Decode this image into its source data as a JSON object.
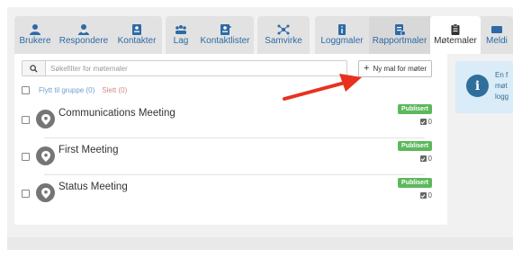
{
  "colors": {
    "link": "#2d6aa6",
    "badge_green": "#5cb85c",
    "annotation_red": "#e8321f",
    "info_bg": "#d9ecf7"
  },
  "tabs_group1": [
    {
      "label": "Brukere",
      "icon": "user-icon"
    },
    {
      "label": "Respondere",
      "icon": "respondent-icon"
    },
    {
      "label": "Kontakter",
      "icon": "contact-card-icon"
    }
  ],
  "tabs_group2": [
    {
      "label": "Lag",
      "icon": "team-icon"
    },
    {
      "label": "Kontaktlister",
      "icon": "contact-list-icon"
    }
  ],
  "tabs_group3": [
    {
      "label": "Samvirke",
      "icon": "network-icon"
    }
  ],
  "tabs_group4": [
    {
      "label": "Loggmaler",
      "icon": "log-template-icon"
    },
    {
      "label": "Rapportmaler",
      "icon": "report-template-icon"
    },
    {
      "label": "Møtemaler",
      "icon": "clipboard-icon"
    },
    {
      "label": "Meldi",
      "icon": "message-icon"
    }
  ],
  "search": {
    "placeholder": "Søkefilter for møtemaler",
    "icon": "search-icon"
  },
  "new_button": {
    "label": "Ny mal for møter"
  },
  "bulk": {
    "move_label": "Flytt til gruppe (0)",
    "delete_label": "Slett (0)"
  },
  "rows": [
    {
      "title": "Communications Meeting",
      "status": "Publisert",
      "count": "0"
    },
    {
      "title": "First Meeting",
      "status": "Publisert",
      "count": "0"
    },
    {
      "title": "Status Meeting",
      "status": "Publisert",
      "count": "0"
    }
  ],
  "info": {
    "line1": "En f",
    "line2": "møt",
    "line3": "logg"
  }
}
